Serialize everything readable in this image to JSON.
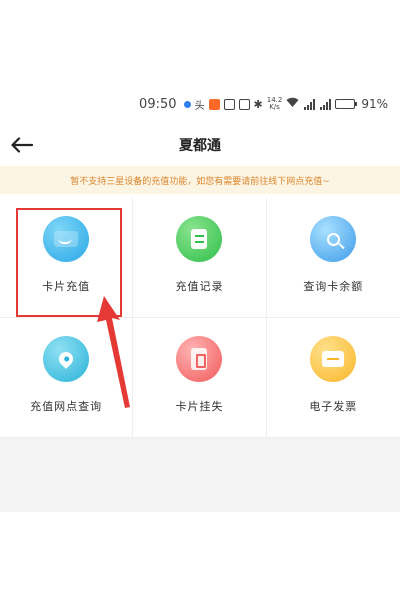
{
  "status_bar": {
    "time": "09:50",
    "network_speed_value": "14.2",
    "network_speed_unit": "K/s",
    "battery_percent": "91%",
    "battery_level": 0.91
  },
  "nav": {
    "title": "夏都通",
    "back_icon": "back-arrow-icon"
  },
  "notice": {
    "text": "暂不支持三星设备的充值功能，如您有需要请前往线下网点充值~"
  },
  "grid": {
    "items": [
      {
        "label": "卡片充值",
        "icon": "card-recharge-icon"
      },
      {
        "label": "充值记录",
        "icon": "recharge-record-icon"
      },
      {
        "label": "查询卡余额",
        "icon": "card-balance-icon"
      },
      {
        "label": "充值网点查询",
        "icon": "recharge-outlet-icon"
      },
      {
        "label": "卡片挂失",
        "icon": "card-lost-icon"
      },
      {
        "label": "电子发票",
        "icon": "e-invoice-icon"
      }
    ]
  },
  "annotation": {
    "highlight_color": "#e53935"
  },
  "colors": {
    "notice_bg": "#fdf5e4",
    "notice_text": "#d9842a"
  }
}
